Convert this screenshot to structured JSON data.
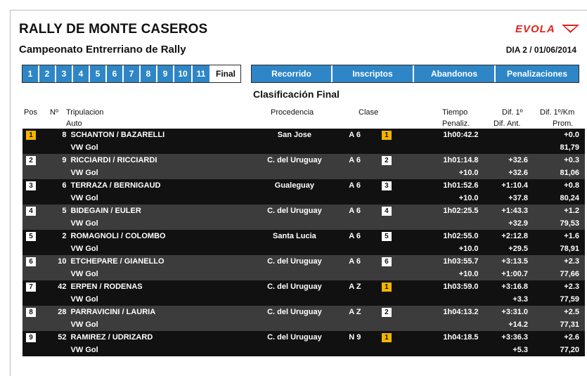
{
  "header": {
    "title": "RALLY DE MONTE CASEROS",
    "subtitle": "Campeonato Entrerriano de Rally",
    "date": "DIA 2 / 01/06/2014",
    "logo_text": "EVOLA"
  },
  "stages": [
    "1",
    "2",
    "3",
    "4",
    "5",
    "6",
    "7",
    "8",
    "9",
    "10",
    "11",
    "Final"
  ],
  "nav_tabs": [
    "Recorrido",
    "Inscriptos",
    "Abandonos",
    "Penalizaciones"
  ],
  "section_title": "Clasificación Final",
  "columns": {
    "pos": "Pos",
    "no": "Nº",
    "crew": "Tripulacion",
    "car": "Auto",
    "origin": "Procedencia",
    "class": "Clase",
    "time": "Tiempo",
    "penalty": "Penaliz.",
    "dif1": "Dif. 1º",
    "difprev": "Dif. Ant.",
    "difkm": "Dif. 1º/Km",
    "avg": "Prom."
  },
  "colors": {
    "accent_blue": "#2e86c6",
    "gold": "#f5b400",
    "penalty": "#f08080",
    "logo_red": "#e1241c"
  },
  "results": [
    {
      "pos": "1",
      "no": "8",
      "crew": "SCHANTON / BAZARELLI",
      "car": "VW Gol",
      "origin": "San Jose",
      "cls": "A 6",
      "cls_pos": "1",
      "time": "1h00:42.2",
      "pen": "",
      "dif1": "",
      "difprev": "",
      "difkm": "+0.0",
      "avg": "81,79"
    },
    {
      "pos": "2",
      "no": "9",
      "crew": "RICCIARDI / RICCIARDI",
      "car": "VW Gol",
      "origin": "C. del Uruguay",
      "cls": "A 6",
      "cls_pos": "2",
      "time": "1h01:14.8",
      "pen": "+10.0",
      "dif1": "+32.6",
      "difprev": "+32.6",
      "difkm": "+0.3",
      "avg": "81,06"
    },
    {
      "pos": "3",
      "no": "6",
      "crew": "TERRAZA / BERNIGAUD",
      "car": "VW Gol",
      "origin": "Gualeguay",
      "cls": "A 6",
      "cls_pos": "3",
      "time": "1h01:52.6",
      "pen": "+10.0",
      "dif1": "+1:10.4",
      "difprev": "+37.8",
      "difkm": "+0.8",
      "avg": "80,24"
    },
    {
      "pos": "4",
      "no": "5",
      "crew": "BIDEGAIN / EULER",
      "car": "VW Gol",
      "origin": "C. del Uruguay",
      "cls": "A 6",
      "cls_pos": "4",
      "time": "1h02:25.5",
      "pen": "",
      "dif1": "+1:43.3",
      "difprev": "+32.9",
      "difkm": "+1.2",
      "avg": "79,53"
    },
    {
      "pos": "5",
      "no": "2",
      "crew": "ROMAGNOLI / COLOMBO",
      "car": "VW Gol",
      "origin": "Santa Lucia",
      "cls": "A 6",
      "cls_pos": "5",
      "time": "1h02:55.0",
      "pen": "+10.0",
      "dif1": "+2:12.8",
      "difprev": "+29.5",
      "difkm": "+1.6",
      "avg": "78,91"
    },
    {
      "pos": "6",
      "no": "10",
      "crew": "ETCHEPARE / GIANELLO",
      "car": "VW Gol",
      "origin": "C. del Uruguay",
      "cls": "A 6",
      "cls_pos": "6",
      "time": "1h03:55.7",
      "pen": "+10.0",
      "dif1": "+3:13.5",
      "difprev": "+1:00.7",
      "difkm": "+2.3",
      "avg": "77,66"
    },
    {
      "pos": "7",
      "no": "42",
      "crew": "ERPEN / RODENAS",
      "car": "VW Gol",
      "origin": "C. del Uruguay",
      "cls": "A Z",
      "cls_pos": "1",
      "time": "1h03:59.0",
      "pen": "",
      "dif1": "+3:16.8",
      "difprev": "+3.3",
      "difkm": "+2.3",
      "avg": "77,59"
    },
    {
      "pos": "8",
      "no": "28",
      "crew": "PARRAVICINI / LAURIA",
      "car": "VW Gol",
      "origin": "C. del Uruguay",
      "cls": "A Z",
      "cls_pos": "2",
      "time": "1h04:13.2",
      "pen": "",
      "dif1": "+3:31.0",
      "difprev": "+14.2",
      "difkm": "+2.5",
      "avg": "77,31"
    },
    {
      "pos": "9",
      "no": "52",
      "crew": "RAMIREZ / UDRIZARD",
      "car": "VW Gol",
      "origin": "C. del Uruguay",
      "cls": "N 9",
      "cls_pos": "1",
      "time": "1h04:18.5",
      "pen": "",
      "dif1": "+3:36.3",
      "difprev": "+5.3",
      "difkm": "+2.6",
      "avg": "77,20"
    }
  ]
}
